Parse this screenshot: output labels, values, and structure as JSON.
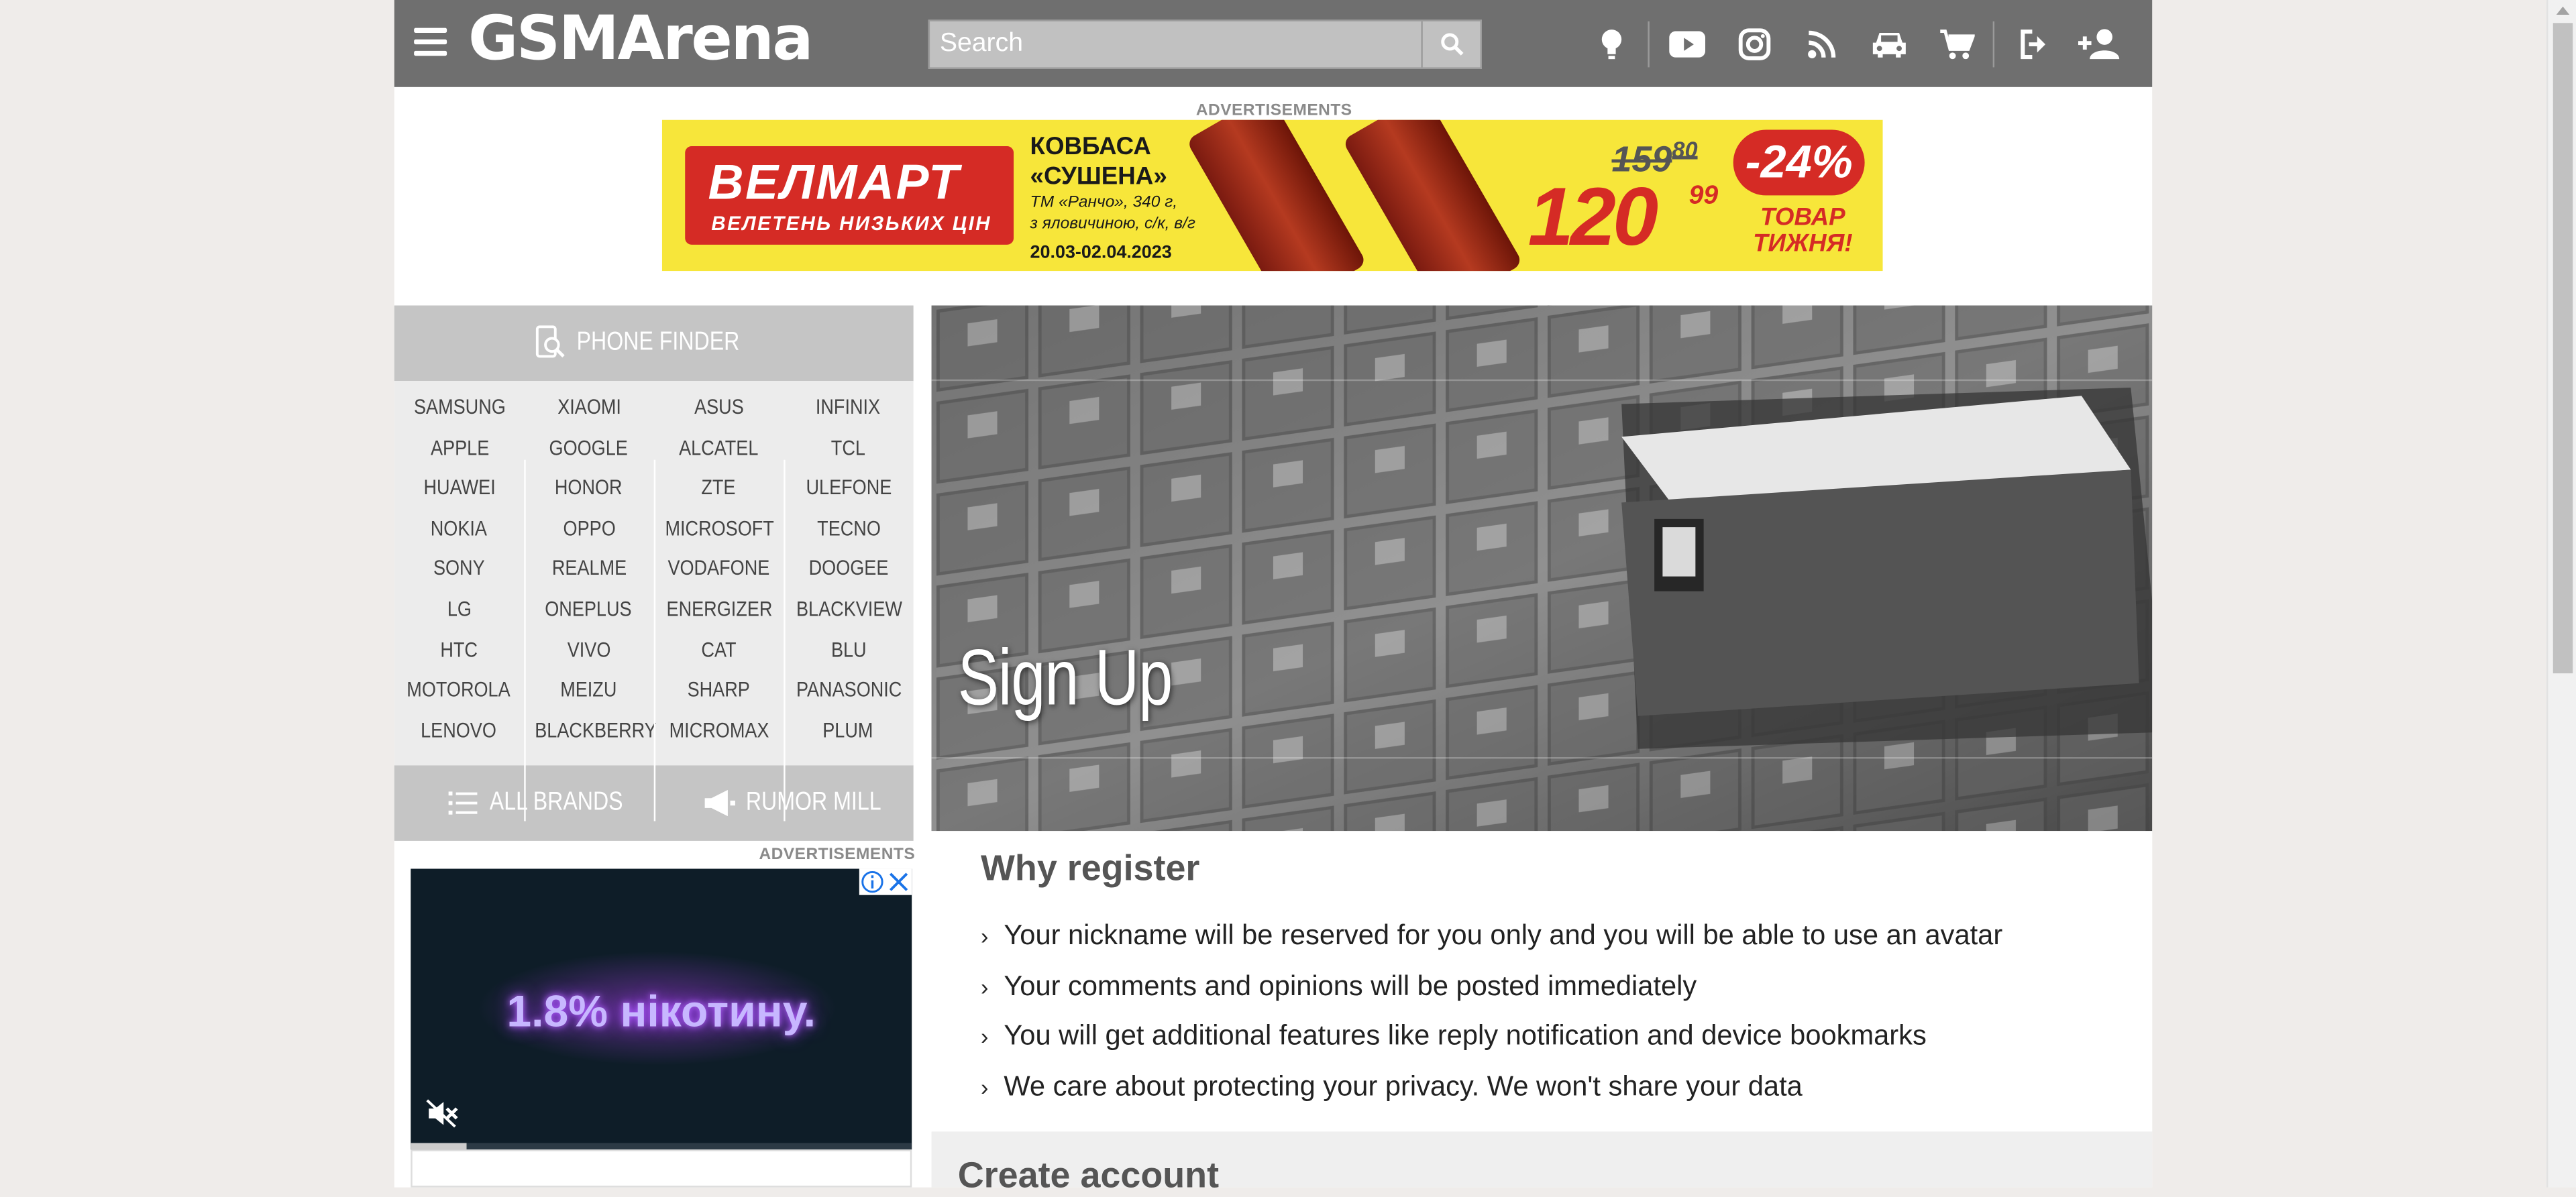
{
  "header": {
    "logo": "GSMArena",
    "search_placeholder": "Search",
    "icons": [
      "tip-icon",
      "youtube-icon",
      "instagram-icon",
      "rss-icon",
      "car-icon",
      "cart-icon",
      "login-icon",
      "add-user-icon"
    ]
  },
  "top_ad": {
    "label": "ADVERTISEMENTS",
    "brand": "ВЕЛМАРТ",
    "brand_tagline": "ВЕЛЕТЕНЬ НИЗЬКИХ ЦІН",
    "product_title_1": "КОВБАСА",
    "product_title_2": "«СУШЕНА»",
    "product_desc_1": "ТМ «Ранчо», 340 г,",
    "product_desc_2": "з яловичиною, с/к, в/г",
    "dates": "20.03-02.04.2023",
    "old_price": "159",
    "old_cents": "80",
    "new_price": "120",
    "new_cents": "99",
    "discount": "-24%",
    "tag_1": "ТОВАР",
    "tag_2": "ТИЖНЯ!"
  },
  "sidebar": {
    "phone_finder": "PHONE FINDER",
    "brand_columns": [
      [
        "SAMSUNG",
        "APPLE",
        "HUAWEI",
        "NOKIA",
        "SONY",
        "LG",
        "HTC",
        "MOTOROLA",
        "LENOVO"
      ],
      [
        "XIAOMI",
        "GOOGLE",
        "HONOR",
        "OPPO",
        "REALME",
        "ONEPLUS",
        "VIVO",
        "MEIZU",
        "BLACKBERRY"
      ],
      [
        "ASUS",
        "ALCATEL",
        "ZTE",
        "MICROSOFT",
        "VODAFONE",
        "ENERGIZER",
        "CAT",
        "SHARP",
        "MICROMAX"
      ],
      [
        "INFINIX",
        "TCL",
        "ULEFONE",
        "TECNO",
        "DOOGEE",
        "BLACKVIEW",
        "BLU",
        "PANASONIC",
        "PLUM"
      ]
    ],
    "all_brands": "ALL BRANDS",
    "rumor_mill": "RUMOR MILL",
    "ad_label": "ADVERTISEMENTS",
    "ad_text": "1.8% нікотину."
  },
  "main": {
    "hero_title": "Sign Up",
    "why_title": "Why register",
    "reasons": [
      "Your nickname will be reserved for you only and you will be able to use an avatar",
      "Your comments and opinions will be posted immediately",
      "You will get additional features like reply notification and device bookmarks",
      "We care about protecting your privacy. We won't share your data"
    ],
    "create_title": "Create account"
  }
}
